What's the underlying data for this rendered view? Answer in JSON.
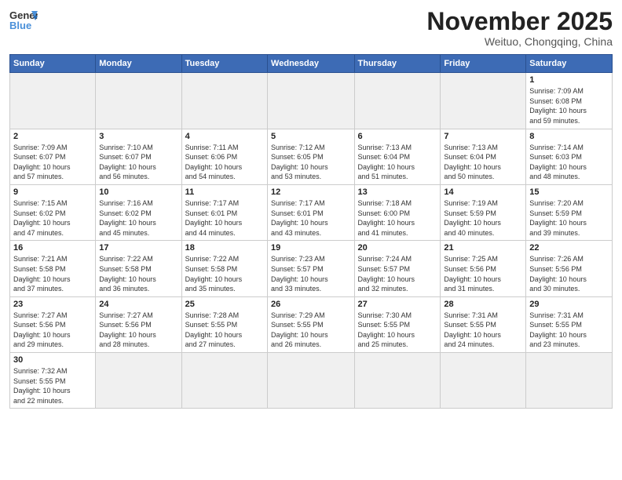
{
  "header": {
    "logo_general": "General",
    "logo_blue": "Blue",
    "month_title": "November 2025",
    "subtitle": "Weituo, Chongqing, China"
  },
  "weekdays": [
    "Sunday",
    "Monday",
    "Tuesday",
    "Wednesday",
    "Thursday",
    "Friday",
    "Saturday"
  ],
  "weeks": [
    [
      {
        "day": "",
        "info": ""
      },
      {
        "day": "",
        "info": ""
      },
      {
        "day": "",
        "info": ""
      },
      {
        "day": "",
        "info": ""
      },
      {
        "day": "",
        "info": ""
      },
      {
        "day": "",
        "info": ""
      },
      {
        "day": "1",
        "info": "Sunrise: 7:09 AM\nSunset: 6:08 PM\nDaylight: 10 hours\nand 59 minutes."
      }
    ],
    [
      {
        "day": "2",
        "info": "Sunrise: 7:09 AM\nSunset: 6:07 PM\nDaylight: 10 hours\nand 57 minutes."
      },
      {
        "day": "3",
        "info": "Sunrise: 7:10 AM\nSunset: 6:07 PM\nDaylight: 10 hours\nand 56 minutes."
      },
      {
        "day": "4",
        "info": "Sunrise: 7:11 AM\nSunset: 6:06 PM\nDaylight: 10 hours\nand 54 minutes."
      },
      {
        "day": "5",
        "info": "Sunrise: 7:12 AM\nSunset: 6:05 PM\nDaylight: 10 hours\nand 53 minutes."
      },
      {
        "day": "6",
        "info": "Sunrise: 7:13 AM\nSunset: 6:04 PM\nDaylight: 10 hours\nand 51 minutes."
      },
      {
        "day": "7",
        "info": "Sunrise: 7:13 AM\nSunset: 6:04 PM\nDaylight: 10 hours\nand 50 minutes."
      },
      {
        "day": "8",
        "info": "Sunrise: 7:14 AM\nSunset: 6:03 PM\nDaylight: 10 hours\nand 48 minutes."
      }
    ],
    [
      {
        "day": "9",
        "info": "Sunrise: 7:15 AM\nSunset: 6:02 PM\nDaylight: 10 hours\nand 47 minutes."
      },
      {
        "day": "10",
        "info": "Sunrise: 7:16 AM\nSunset: 6:02 PM\nDaylight: 10 hours\nand 45 minutes."
      },
      {
        "day": "11",
        "info": "Sunrise: 7:17 AM\nSunset: 6:01 PM\nDaylight: 10 hours\nand 44 minutes."
      },
      {
        "day": "12",
        "info": "Sunrise: 7:17 AM\nSunset: 6:01 PM\nDaylight: 10 hours\nand 43 minutes."
      },
      {
        "day": "13",
        "info": "Sunrise: 7:18 AM\nSunset: 6:00 PM\nDaylight: 10 hours\nand 41 minutes."
      },
      {
        "day": "14",
        "info": "Sunrise: 7:19 AM\nSunset: 5:59 PM\nDaylight: 10 hours\nand 40 minutes."
      },
      {
        "day": "15",
        "info": "Sunrise: 7:20 AM\nSunset: 5:59 PM\nDaylight: 10 hours\nand 39 minutes."
      }
    ],
    [
      {
        "day": "16",
        "info": "Sunrise: 7:21 AM\nSunset: 5:58 PM\nDaylight: 10 hours\nand 37 minutes."
      },
      {
        "day": "17",
        "info": "Sunrise: 7:22 AM\nSunset: 5:58 PM\nDaylight: 10 hours\nand 36 minutes."
      },
      {
        "day": "18",
        "info": "Sunrise: 7:22 AM\nSunset: 5:58 PM\nDaylight: 10 hours\nand 35 minutes."
      },
      {
        "day": "19",
        "info": "Sunrise: 7:23 AM\nSunset: 5:57 PM\nDaylight: 10 hours\nand 33 minutes."
      },
      {
        "day": "20",
        "info": "Sunrise: 7:24 AM\nSunset: 5:57 PM\nDaylight: 10 hours\nand 32 minutes."
      },
      {
        "day": "21",
        "info": "Sunrise: 7:25 AM\nSunset: 5:56 PM\nDaylight: 10 hours\nand 31 minutes."
      },
      {
        "day": "22",
        "info": "Sunrise: 7:26 AM\nSunset: 5:56 PM\nDaylight: 10 hours\nand 30 minutes."
      }
    ],
    [
      {
        "day": "23",
        "info": "Sunrise: 7:27 AM\nSunset: 5:56 PM\nDaylight: 10 hours\nand 29 minutes."
      },
      {
        "day": "24",
        "info": "Sunrise: 7:27 AM\nSunset: 5:56 PM\nDaylight: 10 hours\nand 28 minutes."
      },
      {
        "day": "25",
        "info": "Sunrise: 7:28 AM\nSunset: 5:55 PM\nDaylight: 10 hours\nand 27 minutes."
      },
      {
        "day": "26",
        "info": "Sunrise: 7:29 AM\nSunset: 5:55 PM\nDaylight: 10 hours\nand 26 minutes."
      },
      {
        "day": "27",
        "info": "Sunrise: 7:30 AM\nSunset: 5:55 PM\nDaylight: 10 hours\nand 25 minutes."
      },
      {
        "day": "28",
        "info": "Sunrise: 7:31 AM\nSunset: 5:55 PM\nDaylight: 10 hours\nand 24 minutes."
      },
      {
        "day": "29",
        "info": "Sunrise: 7:31 AM\nSunset: 5:55 PM\nDaylight: 10 hours\nand 23 minutes."
      }
    ],
    [
      {
        "day": "30",
        "info": "Sunrise: 7:32 AM\nSunset: 5:55 PM\nDaylight: 10 hours\nand 22 minutes."
      },
      {
        "day": "",
        "info": ""
      },
      {
        "day": "",
        "info": ""
      },
      {
        "day": "",
        "info": ""
      },
      {
        "day": "",
        "info": ""
      },
      {
        "day": "",
        "info": ""
      },
      {
        "day": "",
        "info": ""
      }
    ]
  ]
}
